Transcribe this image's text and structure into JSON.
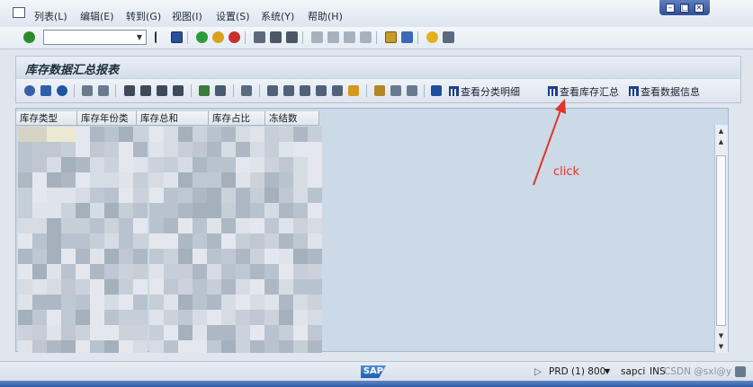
{
  "menu": {
    "items": [
      "列表(L)",
      "编辑(E)",
      "转到(G)",
      "视图(I)",
      "设置(S)",
      "系统(Y)",
      "帮助(H)"
    ]
  },
  "system_toolbar": {
    "command_field": {
      "value": "",
      "placeholder": ""
    },
    "icons": [
      "enter-check-icon",
      "command-dropdown-icon",
      "back-nav-icon",
      "save-icon",
      "back-icon",
      "exit-icon",
      "cancel-icon",
      "print-icon",
      "find-icon",
      "find-next-icon",
      "first-page-icon",
      "previous-page-icon",
      "next-page-icon",
      "last-page-icon",
      "create-session-icon",
      "shortcut-icon",
      "help-icon",
      "layout-icon"
    ]
  },
  "page": {
    "title": "库存数据汇总报表"
  },
  "app_toolbar": {
    "buttons": [
      {
        "label": "查看分类明细",
        "icon": "table-icon"
      },
      {
        "label": "查看库存汇总",
        "icon": "table-icon"
      },
      {
        "label": "查看数据信息",
        "icon": "table-icon"
      }
    ]
  },
  "grid": {
    "columns": [
      "库存类型",
      "库存年份类别",
      "库存总和",
      "库存占比(%)",
      "冻结数"
    ]
  },
  "annotation": {
    "text": "click",
    "color": "#e1342a"
  },
  "status": {
    "logo": "SAP",
    "system": "PRD (1) 800",
    "server": "sapci",
    "mode": "INS",
    "watermark": "CSDN @sxl@y"
  },
  "colors": {
    "accent": "#1f5fae",
    "title_bg": "#d3dde9",
    "grid_bg": "#ccd9e6",
    "annotation": "#e1342a"
  }
}
